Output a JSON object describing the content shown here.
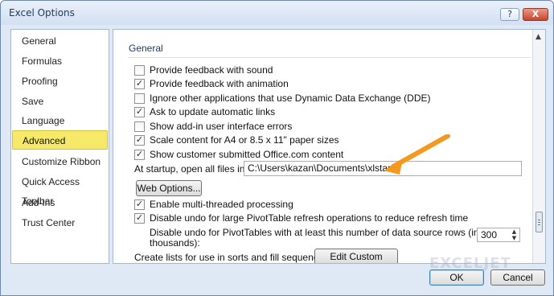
{
  "window": {
    "title": "Excel Options",
    "help_label": "?",
    "close_label": "X"
  },
  "sidebar": {
    "items": [
      {
        "label": "General"
      },
      {
        "label": "Formulas"
      },
      {
        "label": "Proofing"
      },
      {
        "label": "Save"
      },
      {
        "label": "Language"
      },
      {
        "label": "Advanced",
        "selected": true
      },
      {
        "label": "Customize Ribbon"
      },
      {
        "label": "Quick Access Toolbar"
      },
      {
        "label": "Add-Ins"
      },
      {
        "label": "Trust Center"
      }
    ]
  },
  "content": {
    "section_title": "General",
    "options": [
      {
        "label": "Provide feedback with sound",
        "checked": false
      },
      {
        "label": "Provide feedback with animation",
        "checked": true
      },
      {
        "label": "Ignore other applications that use Dynamic Data Exchange (DDE)",
        "checked": false
      },
      {
        "label": "Ask to update automatic links",
        "checked": true
      },
      {
        "label": "Show add-in user interface errors",
        "checked": false
      },
      {
        "label": "Scale content for A4 or 8.5 x 11\" paper sizes",
        "checked": true
      },
      {
        "label": "Show customer submitted Office.com content",
        "checked": true
      }
    ],
    "startup_label": "At startup, open all files in:",
    "startup_value": "C:\\Users\\kazan\\Documents\\xlstart",
    "web_options_label": "Web Options...",
    "options2": [
      {
        "label": "Enable multi-threaded processing",
        "checked": true
      },
      {
        "label": "Disable undo for large PivotTable refresh operations to reduce refresh time",
        "checked": true
      }
    ],
    "undo_rows_label_line1": "Disable undo for PivotTables with at least this number of data source rows (in",
    "undo_rows_label_line2": "thousands):",
    "undo_rows_value": "300",
    "custom_lists_label": "Create lists for use in sorts and fill sequences:",
    "edit_custom_lists_label": "Edit Custom Lists..."
  },
  "footer": {
    "ok_label": "OK",
    "cancel_label": "Cancel",
    "watermark": "EXCELJET"
  },
  "colors": {
    "selected_nav": "#f6e96a",
    "arrow": "#f39a1e"
  },
  "icons": {
    "scroll_up": "triangle-up-icon",
    "arrow": "orange-arrow-icon"
  }
}
